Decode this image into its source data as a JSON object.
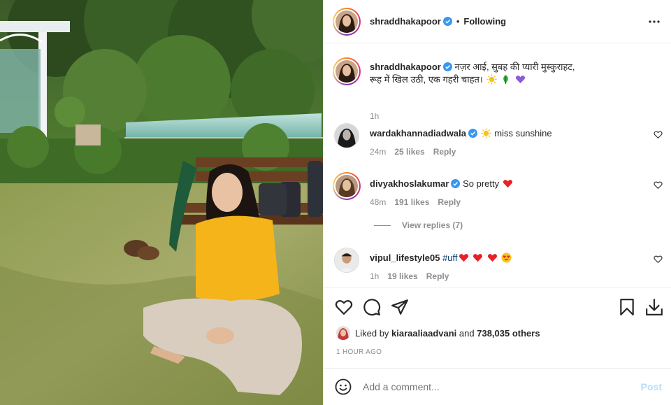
{
  "post": {
    "author": "shraddhakapoor",
    "following_label": "Following",
    "dot": "•"
  },
  "caption": {
    "user": "shraddhakapoor",
    "line1": "नज़र आई, सुबह की प्यारी मुस्कुराहट,",
    "line2": "रूह में खिल उठी, एक गहरी चाहत।",
    "time": "1h"
  },
  "comments": [
    {
      "user": "wardakhannadiadwala",
      "text": "miss sunshine",
      "time": "24m",
      "likes": "25 likes",
      "reply": "Reply"
    },
    {
      "user": "divyakhoslakumar",
      "text": "So pretty",
      "time": "48m",
      "likes": "191 likes",
      "reply": "Reply"
    },
    {
      "user": "vipul_lifestyle05",
      "text": "#uff",
      "time": "1h",
      "likes": "19 likes",
      "reply": "Reply"
    }
  ],
  "view_replies": "View replies (7)",
  "likes": {
    "prefix": "Liked by",
    "user": "kiaraaliaadvani",
    "and": "and",
    "others": "738,035 others"
  },
  "timestamp": "1 HOUR AGO",
  "add_comment": {
    "placeholder": "Add a comment...",
    "post_label": "Post"
  },
  "colors": {
    "verified": "#3897f0",
    "heart_red": "#ed4956",
    "link": "#00376b",
    "muted": "#8e8e8e",
    "post_disabled": "#b2dffc"
  },
  "icons": [
    "verified-icon",
    "more-options-icon",
    "like-icon",
    "comment-icon",
    "share-icon",
    "save-icon",
    "download-icon",
    "emoji-icon",
    "comment-like-icon"
  ]
}
